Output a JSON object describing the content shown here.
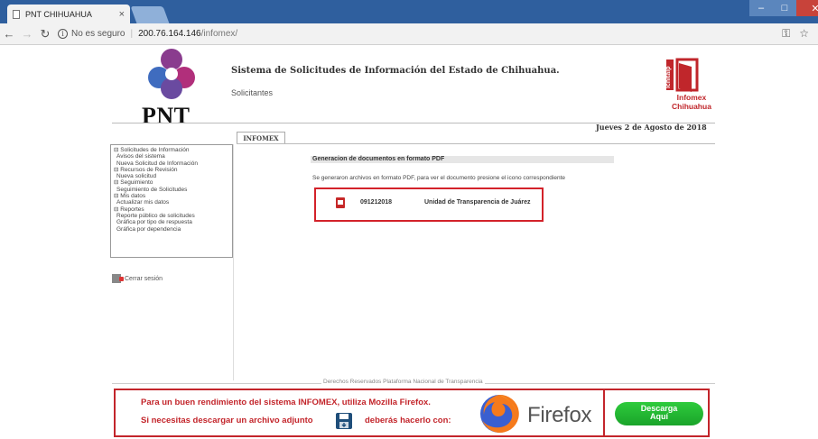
{
  "browser": {
    "tab_title": "PNT CHIHUAHUA",
    "tab_close": "×",
    "url_security": "No es seguro",
    "url_separator": "|",
    "url_host": "200.76.164.146",
    "url_path": "/infomex/",
    "back_icon": "arrow-left-icon",
    "forward_icon": "arrow-right-icon",
    "reload_icon": "reload-icon",
    "key_icon": "key-icon",
    "star_icon": "star-icon"
  },
  "header": {
    "pnt_logo_text": "PNT",
    "system_title": "Sistema de Solicitudes de Información del Estado de Chihuahua.",
    "subtitle": "Solicitantes",
    "infomex_logo_line1": "Infomex",
    "infomex_logo_line2": "Chihuahua",
    "ichitaip_logo_text": "ichitaip",
    "date": "Jueves 2 de Agosto de 2018"
  },
  "tabs": {
    "active": "INFOMEX"
  },
  "sidebar": {
    "items": [
      {
        "label": "⊟ Solicitudes de Información",
        "sub": false
      },
      {
        "label": "Avisos del sistema",
        "sub": true
      },
      {
        "label": "Nueva Solicitud de Información",
        "sub": true
      },
      {
        "label": "⊟ Recursos de Revisión",
        "sub": false
      },
      {
        "label": "Nueva solicitud",
        "sub": true
      },
      {
        "label": "⊟ Seguimiento",
        "sub": false
      },
      {
        "label": "Seguimiento de Solicitudes",
        "sub": true
      },
      {
        "label": "⊟ Mis datos",
        "sub": false
      },
      {
        "label": "Actualizar mis datos",
        "sub": true
      },
      {
        "label": "⊟ Reportes",
        "sub": false
      },
      {
        "label": "Reporte público de solicitudes",
        "sub": true
      },
      {
        "label": "Gráfica por tipo de respuesta",
        "sub": true
      },
      {
        "label": "Gráfica por dependencia",
        "sub": true
      }
    ],
    "logout_label": "Cerrar sesión"
  },
  "main": {
    "section_title": "Generacion de documentos en formato PDF",
    "description": "Se generaron archivos en formato PDF, para ver el documento presione el icono correspondiente",
    "document": {
      "number": "091212018",
      "unit": "Unidad de Transparencia de Juárez",
      "icon": "pdf-icon"
    }
  },
  "footer": {
    "rights": "Derechos Reservados Plataforma Nacional de Transparencia"
  },
  "banner": {
    "line1": "Para un buen rendimiento del sistema INFOMEX, utiliza Mozilla Firefox.",
    "line2": "Si necesitas descargar un archivo adjunto",
    "line3": "deberás hacerlo con:",
    "firefox_word": "Firefox",
    "download_line1": "Descarga",
    "download_line2": "Aquí",
    "accent_color": "#c3252b",
    "button_color": "#22b832"
  }
}
